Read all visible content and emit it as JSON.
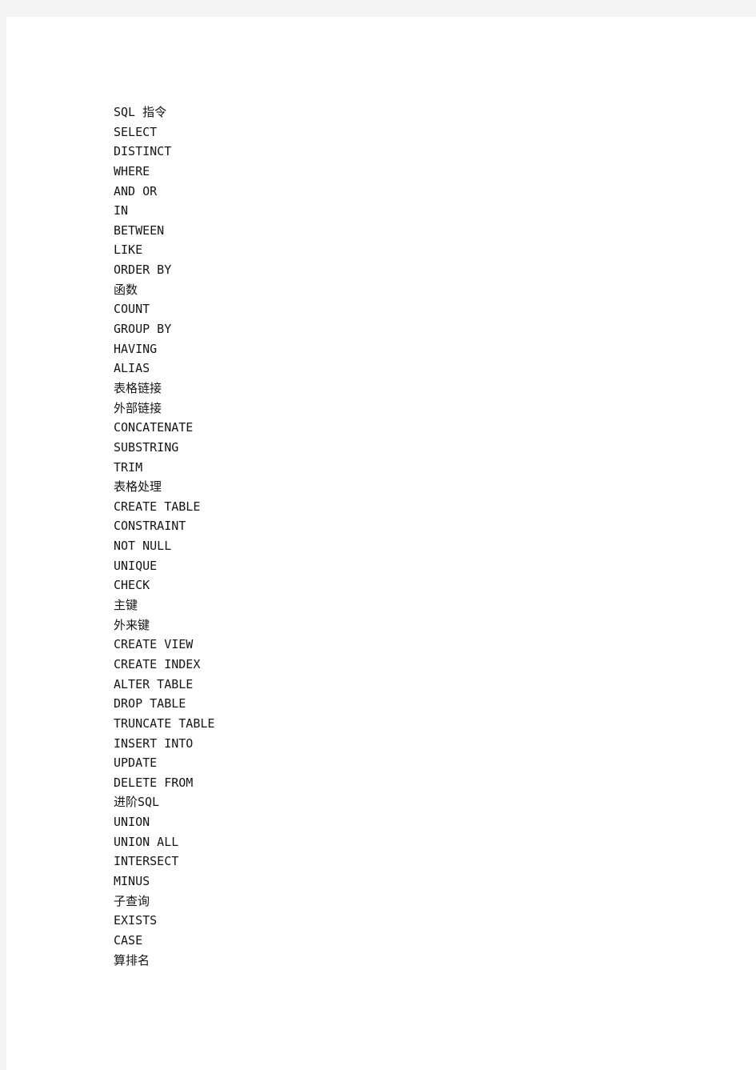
{
  "document": {
    "background_color": "#f4f4f4",
    "page_color": "#ffffff",
    "text_color": "#151515",
    "title": "SQL 指令"
  },
  "toc": {
    "lines": [
      "SQL 指令",
      "SELECT",
      "DISTINCT",
      "WHERE",
      "AND OR",
      "IN",
      "BETWEEN",
      "LIKE",
      "ORDER BY",
      "函数",
      "COUNT",
      "GROUP BY",
      "HAVING",
      "ALIAS",
      "表格链接",
      "外部链接",
      "CONCATENATE",
      "SUBSTRING",
      "TRIM",
      "表格处理",
      "CREATE TABLE",
      "CONSTRAINT",
      "NOT NULL",
      "UNIQUE",
      "CHECK",
      "主键",
      "外来键",
      "CREATE VIEW",
      "CREATE INDEX",
      "ALTER TABLE",
      "DROP TABLE",
      "TRUNCATE TABLE",
      "INSERT INTO",
      "UPDATE",
      "DELETE FROM",
      "进阶SQL",
      "UNION",
      "UNION ALL",
      "INTERSECT",
      "MINUS",
      "子查询",
      "EXISTS",
      "CASE",
      "算排名"
    ]
  }
}
